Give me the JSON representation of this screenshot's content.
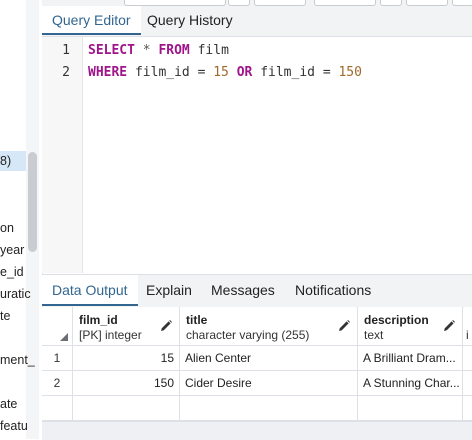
{
  "left_tree": {
    "items": [
      {
        "label": "8)",
        "selected": true
      },
      {
        "label": "on",
        "selected": false
      },
      {
        "label": "year",
        "selected": false
      },
      {
        "label": "e_id",
        "selected": false
      },
      {
        "label": "uratic",
        "selected": false
      },
      {
        "label": "te",
        "selected": false
      },
      {
        "label": "ment_",
        "selected": false
      },
      {
        "label": "ate",
        "selected": false
      },
      {
        "label": "featu",
        "selected": false
      }
    ]
  },
  "editor_tabs": [
    {
      "label": "Query Editor",
      "active": true
    },
    {
      "label": "Query History",
      "active": false
    }
  ],
  "editor": {
    "line_numbers": [
      "1",
      "2"
    ],
    "line1": {
      "kw1": "SELECT",
      "star": " * ",
      "kw2": "FROM",
      "rest": " film"
    },
    "line2": {
      "kw1": "WHERE",
      "col1": " film_id = ",
      "num1": "15",
      "kw2": " OR ",
      "col2": "film_id = ",
      "num2": "150"
    }
  },
  "output_tabs": [
    {
      "label": "Data Output",
      "active": true
    },
    {
      "label": "Explain",
      "active": false
    },
    {
      "label": "Messages",
      "active": false
    },
    {
      "label": "Notifications",
      "active": false
    }
  ],
  "grid": {
    "columns": [
      {
        "name": "film_id",
        "type": "[PK] integer"
      },
      {
        "name": "title",
        "type": "character varying (255)"
      },
      {
        "name": "description",
        "type": "text"
      },
      {
        "name": "",
        "type": "i"
      }
    ],
    "rows": [
      {
        "num": "1",
        "film_id": "15",
        "title": "Alien Center",
        "description": "A Brilliant Dram..."
      },
      {
        "num": "2",
        "film_id": "150",
        "title": "Cider Desire",
        "description": "A Stunning Char..."
      }
    ]
  }
}
